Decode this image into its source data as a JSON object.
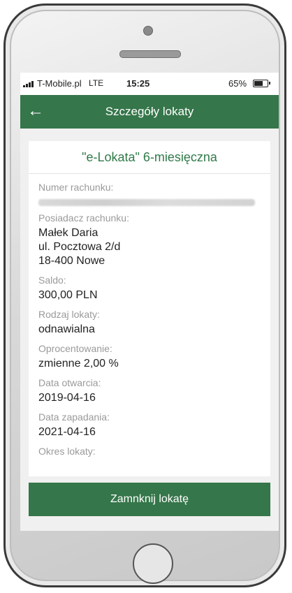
{
  "status_bar": {
    "carrier": "T-Mobile.pl",
    "network": "LTE",
    "time": "15:25",
    "battery_percent": "65%"
  },
  "header": {
    "back_icon": "arrow-left-icon",
    "title": "Szczegóły lokaty"
  },
  "deposit": {
    "name": "\"e-Lokata\" 6-miesięczna",
    "fields": {
      "account_number": {
        "label": "Numer rachunku:",
        "value": ""
      },
      "holder": {
        "label": "Posiadacz rachunku:",
        "lines": [
          "Małek Daria",
          "ul. Pocztowa 2/d",
          "18-400 Nowe"
        ]
      },
      "balance": {
        "label": "Saldo:",
        "value": "300,00 PLN"
      },
      "type": {
        "label": "Rodzaj lokaty:",
        "value": "odnawialna"
      },
      "interest": {
        "label": "Oprocentowanie:",
        "value": "zmienne 2,00 %"
      },
      "opened": {
        "label": "Data otwarcia:",
        "value": "2019-04-16"
      },
      "maturity": {
        "label": "Data zapadania:",
        "value": "2021-04-16"
      },
      "period": {
        "label": "Okres lokaty:"
      }
    }
  },
  "actions": {
    "close_deposit": "Zamnknij lokatę"
  },
  "colors": {
    "primary_green": "#35764a",
    "title_green": "#2f7a48"
  }
}
